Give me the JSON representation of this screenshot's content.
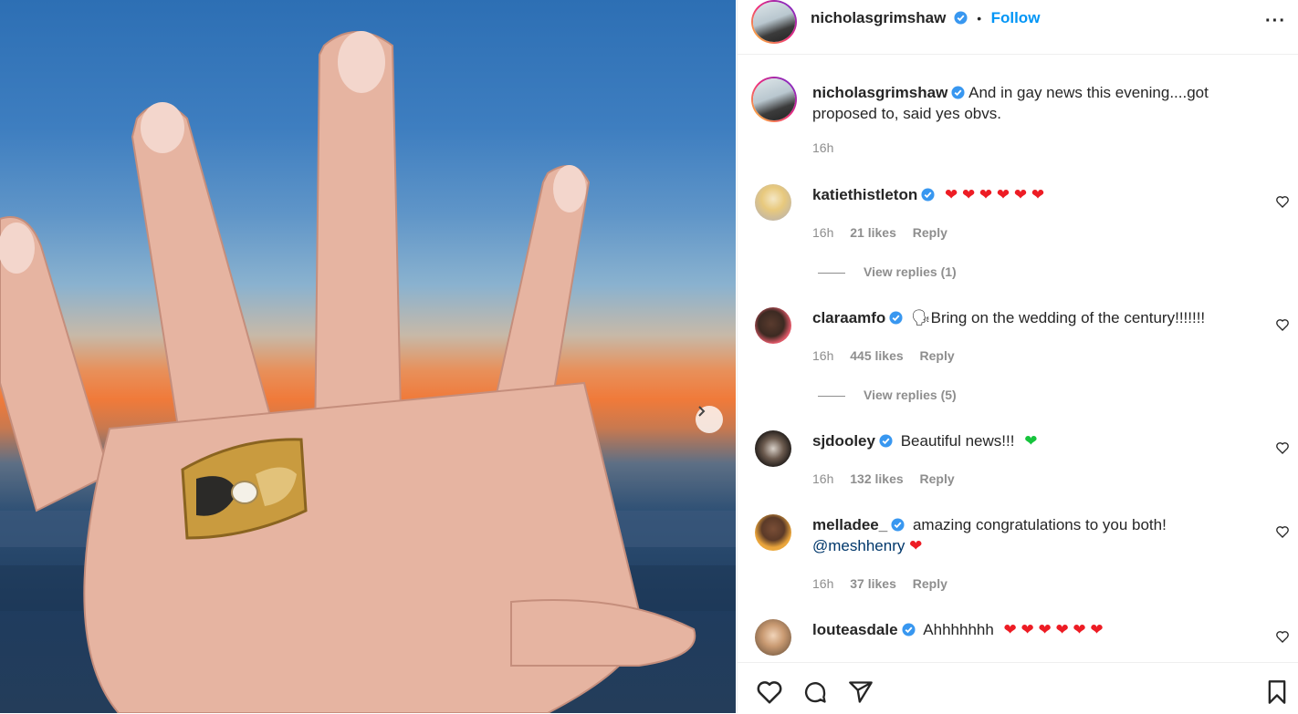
{
  "post": {
    "author": "nicholasgrimshaw",
    "follow_label": "Follow",
    "separator": "•",
    "more_label": "···",
    "caption": "And in gay news this evening....got proposed to, said yes obvs.",
    "caption_time": "16h"
  },
  "comments": [
    {
      "user": "katiethistleton",
      "text": "",
      "hearts": "❤ ❤ ❤ ❤ ❤ ❤",
      "time": "16h",
      "likes": "21 likes",
      "reply": "Reply",
      "view_replies": "View replies (1)"
    },
    {
      "user": "claraamfo",
      "text": "🗣Bring on the wedding of the century!!!!!!!",
      "time": "16h",
      "likes": "445 likes",
      "reply": "Reply",
      "view_replies": "View replies (5)"
    },
    {
      "user": "sjdooley",
      "text": "Beautiful news!!!",
      "green_heart": "❤",
      "time": "16h",
      "likes": "132 likes",
      "reply": "Reply"
    },
    {
      "user": "melladee_",
      "text": "amazing congratulations to you both!",
      "mention": "@meshhenry",
      "heart": "❤",
      "time": "16h",
      "likes": "37 likes",
      "reply": "Reply"
    },
    {
      "user": "louteasdale",
      "text": "Ahhhhhhh",
      "hearts": "❤ ❤ ❤ ❤ ❤ ❤"
    }
  ],
  "colors": {
    "accent": "#0095f6",
    "verified": "#3897f0",
    "heart": "#ed1c24",
    "green_heart": "#16c43c"
  }
}
